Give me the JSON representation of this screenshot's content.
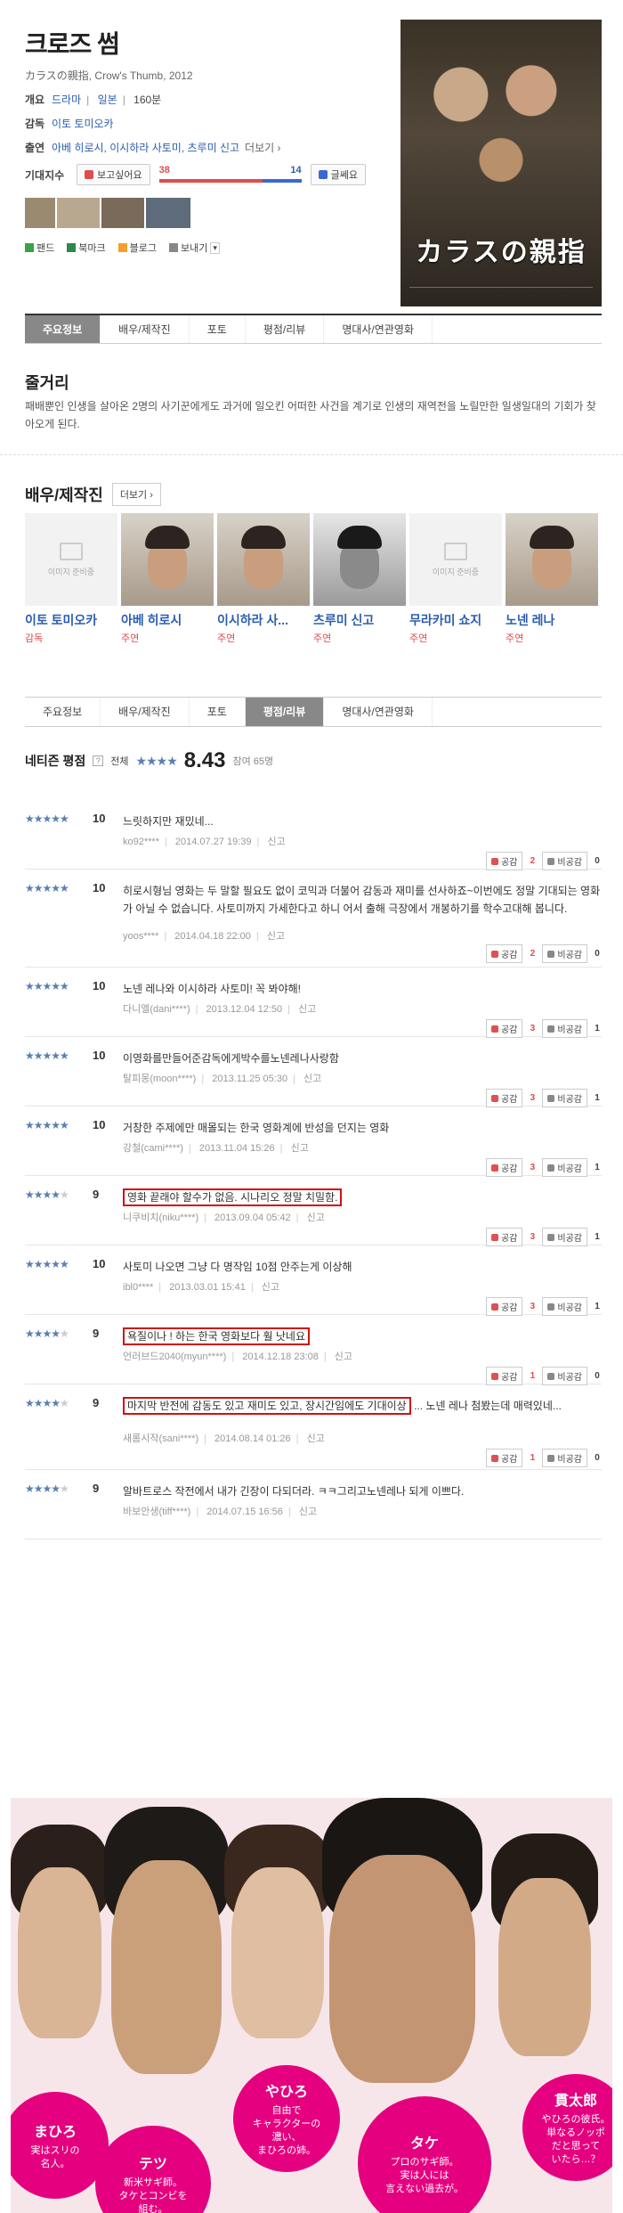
{
  "movie": {
    "title": "크로즈 썸",
    "subtitle": "カラスの親指, Crow's Thumb, 2012",
    "overview_key": "개요",
    "overview": {
      "genre": "드라마",
      "country": "일본",
      "runtime": "160분"
    },
    "director_key": "감독",
    "director": "이토 토미오카",
    "cast_key": "출연",
    "cast_line": "아베 히로시, 이시하라 사토미, 츠루미 신고",
    "cast_more": "더보기 ›",
    "expect_key": "기대지수",
    "want_btn": "보고싶어요",
    "meh_btn": "글쎄요",
    "want_count": "38",
    "meh_count": "14",
    "want_ratio": 0.73,
    "poster_title": "カラスの親指"
  },
  "share": {
    "fan": "팬드",
    "bookmark": "북마크",
    "blog": "블로그",
    "send": "보내기"
  },
  "tabs": [
    "주요정보",
    "배우/제작진",
    "포토",
    "평점/리뷰",
    "명대사/연관영화"
  ],
  "synopsis": {
    "title": "줄거리",
    "text": "패배뿐인 인생을 살아온 2명의 사기꾼에게도 과거에 일오킨 어떠한 사건을 계기로 인생의 재역전을 노릴만한 일생일대의 기회가 찾아오게 된다."
  },
  "cast_section": {
    "title": "배우/제작진",
    "more": "더보기 ›",
    "no_image": "이미지 준비중",
    "members": [
      {
        "name": "이토 토미오카",
        "role": "감독",
        "photo": "none"
      },
      {
        "name": "아베 히로시",
        "role": "주연",
        "photo": "real"
      },
      {
        "name": "이시하라 사...",
        "role": "주연",
        "photo": "real"
      },
      {
        "name": "츠루미 신고",
        "role": "주연",
        "photo": "bw"
      },
      {
        "name": "무라카미 쇼지",
        "role": "주연",
        "photo": "none"
      },
      {
        "name": "노넨 레나",
        "role": "주연",
        "photo": "real"
      }
    ]
  },
  "netizen": {
    "title": "네티즌 평점",
    "all": "전체",
    "stars": "★★★★",
    "score": "8.43",
    "count": "참여 65명"
  },
  "vote_labels": {
    "up": "공감",
    "down": "비공감",
    "report": "신고"
  },
  "reviews": [
    {
      "score": "10",
      "stars": 5,
      "text": "느릿하지만 재밌네...",
      "meta_user": "ko92****",
      "meta_date": "2014.07.27 19:39",
      "up": "2",
      "down": "0",
      "highlight": false
    },
    {
      "score": "10",
      "stars": 5,
      "text": "히로시형님 영화는 두 말할 필요도 없이 코믹과 더불어 감동과 재미를 선사하죠~이번에도 정말 기대되는 영화가 아닐 수 없습니다. 사토미까지 가세한다고 하니 어서 출해 극장에서 개봉하기를 학수고대해 봅니다.",
      "meta_user": "yoos****",
      "meta_date": "2014.04.18 22:00",
      "up": "2",
      "down": "0",
      "highlight": false
    },
    {
      "score": "10",
      "stars": 5,
      "text": "노넨 레나와 이시하라 사토미! 꼭 봐야해!",
      "meta_user": "다니엘(dani****)",
      "meta_date": "2013.12.04 12:50",
      "up": "3",
      "down": "1",
      "highlight": false
    },
    {
      "score": "10",
      "stars": 5,
      "text": "이영화를만들어준감독에게박수를노넨레나사랑함",
      "meta_user": "탈피몽(moon****)",
      "meta_date": "2013.11.25 05:30",
      "up": "3",
      "down": "1",
      "highlight": false
    },
    {
      "score": "10",
      "stars": 5,
      "text": "거창한 주제에만 매몰되는 한국 영화계에 반성을 던지는 영화",
      "meta_user": "강철(cami****)",
      "meta_date": "2013.11.04 15:26",
      "up": "3",
      "down": "1",
      "highlight": false
    },
    {
      "score": "9",
      "stars": 4,
      "text": "영화 끝래야 할수가 없음. 시나리오 정말 치밀함.",
      "meta_user": "니쿠비치(niku****)",
      "meta_date": "2013.09.04 05:42",
      "up": "3",
      "down": "1",
      "highlight": true
    },
    {
      "score": "10",
      "stars": 5,
      "text": "사토미 나오면 그냥 다 명작임 10점 안주는게 이상해",
      "meta_user": "ibl0****",
      "meta_date": "2013.03.01 15:41",
      "up": "3",
      "down": "1",
      "highlight": false
    },
    {
      "score": "9",
      "stars": 4,
      "text": "욕질이나 ! 하는 한국 영화보다 훨 낫네요",
      "meta_user": "언러브드2040(myun****)",
      "meta_date": "2014.12.18 23:08",
      "up": "1",
      "down": "0",
      "highlight": true
    },
    {
      "score": "9",
      "stars": 4,
      "text": "마지막 반전에 감동도 있고 재미도 있고, 장시간임에도 기대이상",
      "text_tail": "... 노넨 레나 첨봤는데 매력있네...",
      "meta_user": "새롬시작(sani****)",
      "meta_date": "2014.08.14 01:26",
      "up": "1",
      "down": "0",
      "highlight": true
    },
    {
      "score": "9",
      "stars": 4,
      "text": "알바트로스 작전에서 내가 긴장이 다되더라. ㅋㅋ그리고노넨레나 되게 이쁘다.",
      "meta_user": "바보안생(tiff****)",
      "meta_date": "2014.07.15 16:56",
      "up": "",
      "down": "",
      "highlight": false
    }
  ],
  "promo": {
    "characters": [
      {
        "name": "まひろ",
        "desc": "実はスリの\n名人。"
      },
      {
        "name": "テツ",
        "desc": "新米サギ師。\nタケとコンビを\n組む。"
      },
      {
        "name": "やひろ",
        "desc": "自由で\nキャラクターの\n濃い、\nまひろの姉。"
      },
      {
        "name": "タケ",
        "desc": "プロのサギ師。\n実は人には\n言えない過去が。"
      },
      {
        "name": "貫太郎",
        "desc": "やひろの彼氏。\n単なるノッポ\nだと思って\nいたら…？"
      }
    ]
  },
  "colors": {
    "accent_red": "#e04b4b",
    "link_blue": "#2a5db0",
    "promo_pink": "#e5007f",
    "star_blue": "#5a7fb0"
  }
}
